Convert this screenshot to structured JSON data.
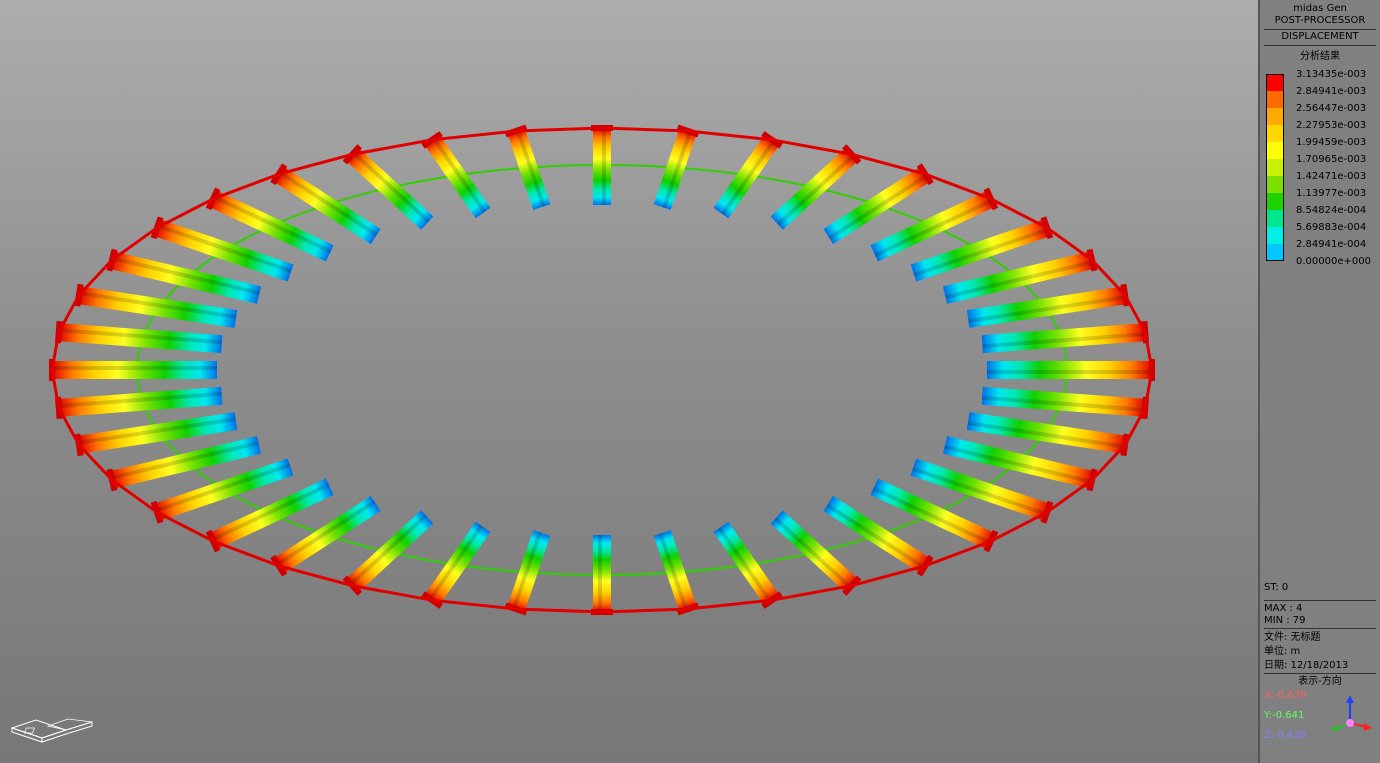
{
  "panel": {
    "title": "midas Gen",
    "subtitle": "POST-PROCESSOR",
    "mode": "DISPLACEMENT",
    "result_title": "分析结果",
    "legend": [
      {
        "value": "3.13435e-003",
        "color": "#ff0000"
      },
      {
        "value": "2.84941e-003",
        "color": "#ff6a00"
      },
      {
        "value": "2.56447e-003",
        "color": "#ffaa00"
      },
      {
        "value": "2.27953e-003",
        "color": "#ffd800"
      },
      {
        "value": "1.99459e-003",
        "color": "#ffff00"
      },
      {
        "value": "1.70965e-003",
        "color": "#c8f000"
      },
      {
        "value": "1.42471e-003",
        "color": "#7ee000"
      },
      {
        "value": "1.13977e-003",
        "color": "#1ed200"
      },
      {
        "value": "8.54824e-004",
        "color": "#00e68c"
      },
      {
        "value": "5.69883e-004",
        "color": "#00f0e6"
      },
      {
        "value": "2.84941e-004",
        "color": "#00c8ff"
      },
      {
        "value": "0.00000e+000",
        "color": "#0064ff"
      }
    ],
    "step": "ST: 0",
    "max": "MAX : 4",
    "min": "MIN : 79",
    "file": "文件: 无标题",
    "unit": "单位: m",
    "date": "日期: 12/18/2013",
    "view_direction": "表示-方向",
    "view_x": "X:-0.630",
    "view_y": "Y:-0.641",
    "view_z": "Z: 0.438",
    "x_color": "#ff6060",
    "y_color": "#60ff60",
    "z_color": "#8080ff"
  },
  "model": {
    "beam_count": 40,
    "outer_ring_color": "#e00000",
    "inner_ring_color": "#30d000"
  }
}
